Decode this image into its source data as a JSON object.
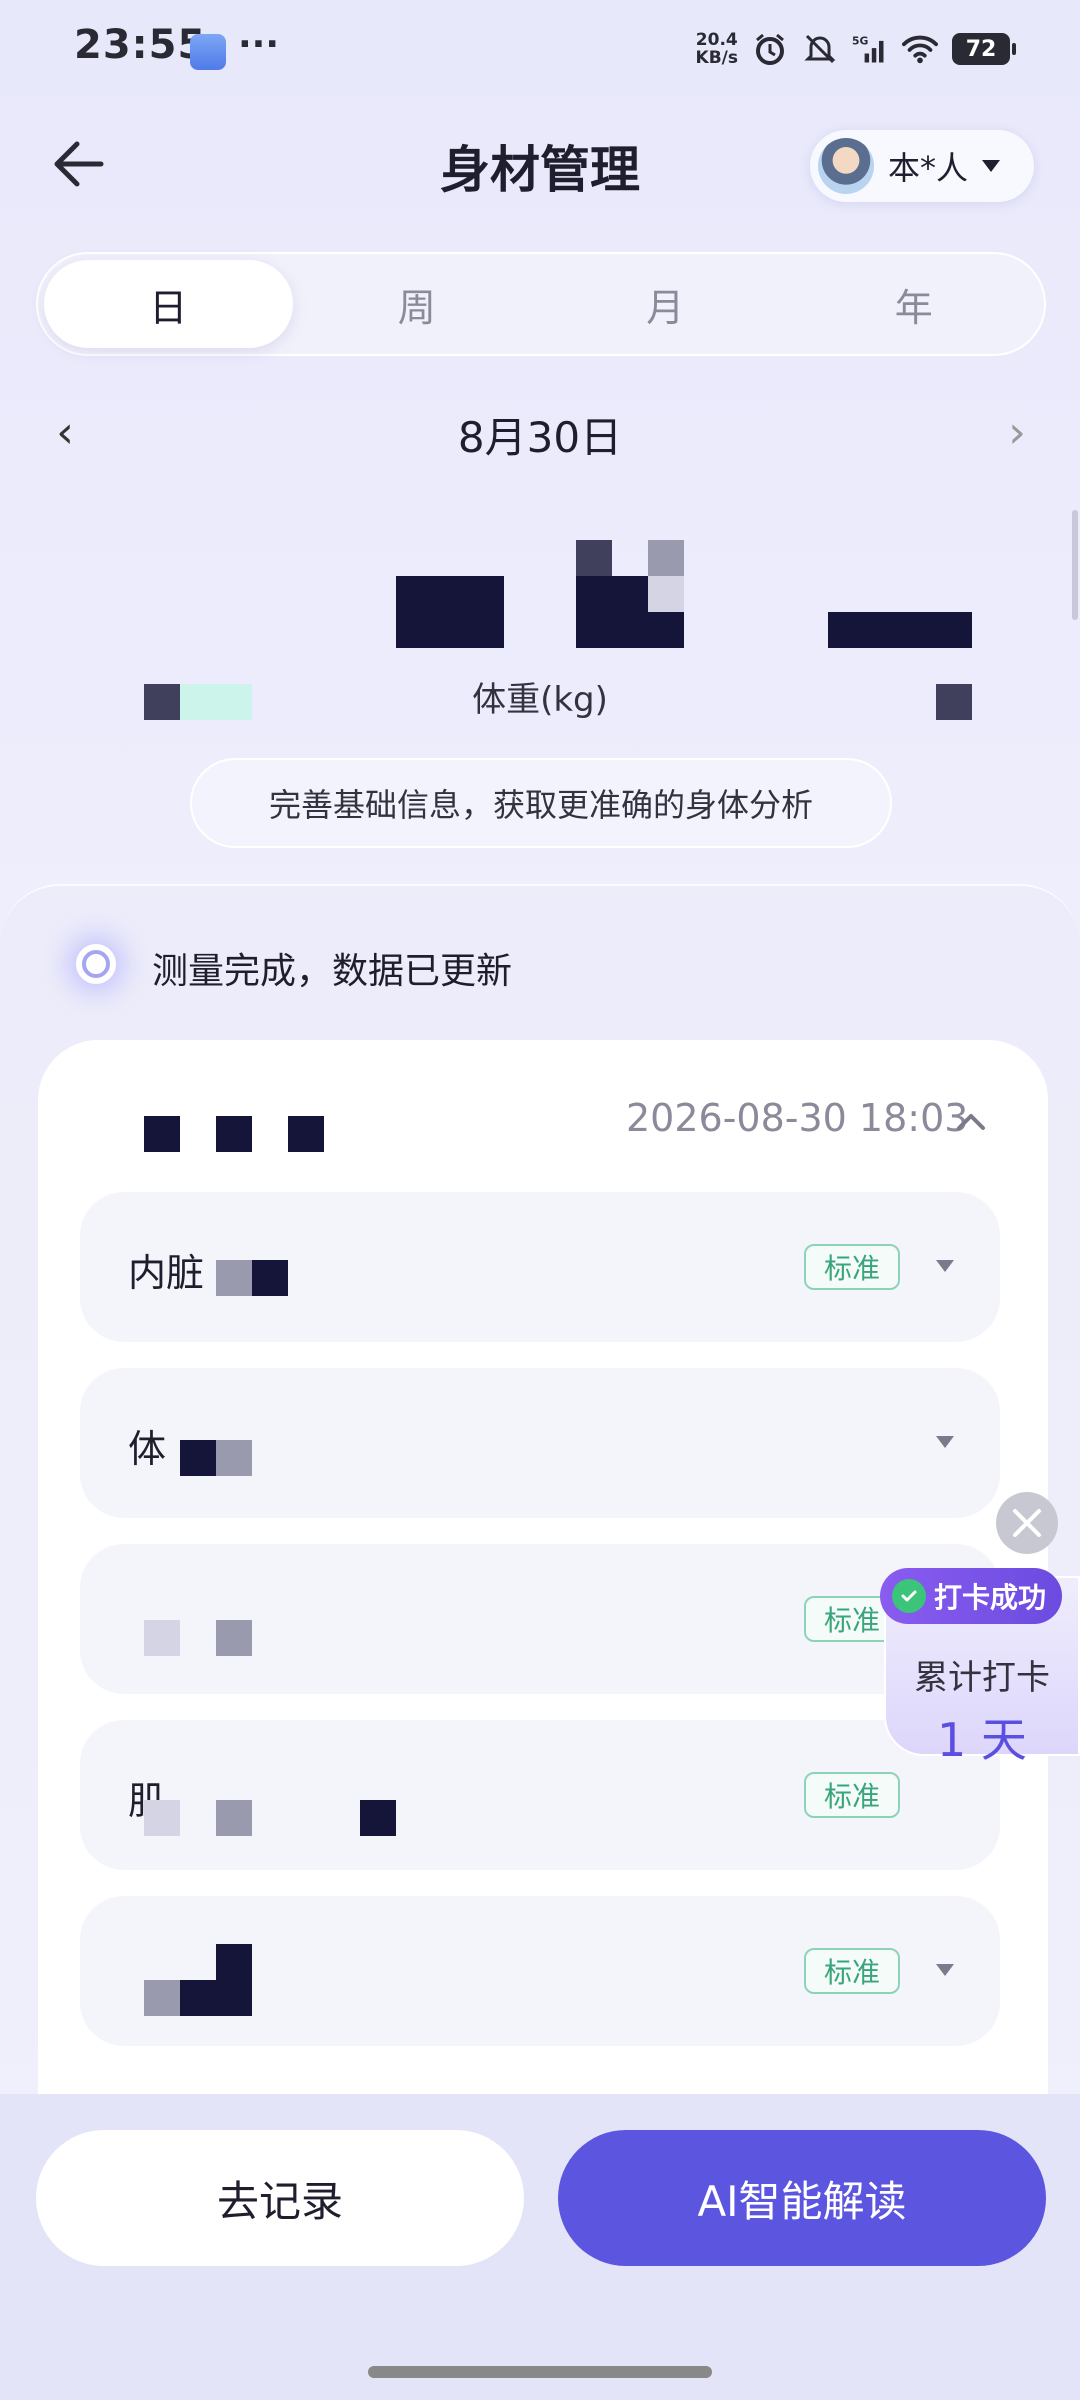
{
  "status_bar": {
    "time": "23:55",
    "overflow": "···",
    "net_speed_value": "20.4",
    "net_speed_unit": "KB/s",
    "network": "5G",
    "battery": "72"
  },
  "header": {
    "title": "身材管理",
    "user_name": "本*人"
  },
  "tabs": [
    {
      "label": "日",
      "active": true
    },
    {
      "label": "周",
      "active": false
    },
    {
      "label": "月",
      "active": false
    },
    {
      "label": "年",
      "active": false
    }
  ],
  "date_nav": {
    "prev": "‹",
    "date": "8月30日",
    "next": "›"
  },
  "summary": {
    "weight_unit_label": "体重(kg)",
    "info_prompt": "完善基础信息，获取更准确的身体分析"
  },
  "measurement": {
    "status": "测量完成，数据已更新",
    "record_time": "2026-08-30 18:03"
  },
  "metrics": [
    {
      "label": "内脏",
      "badge": "标准"
    },
    {
      "label": "体",
      "badge": ""
    },
    {
      "label": "",
      "badge": "标准"
    },
    {
      "label": "肌",
      "badge": "标准"
    },
    {
      "label": "",
      "badge": "标准"
    }
  ],
  "checkin_widget": {
    "badge": "打卡成功",
    "title": "累计打卡",
    "days": "1 天"
  },
  "actions": {
    "record": "去记录",
    "ai": "AI智能解读"
  },
  "colors": {
    "accent": "#5b55e0",
    "badge_green": "#3aa57c",
    "mosaic_dark": "#15153a"
  }
}
